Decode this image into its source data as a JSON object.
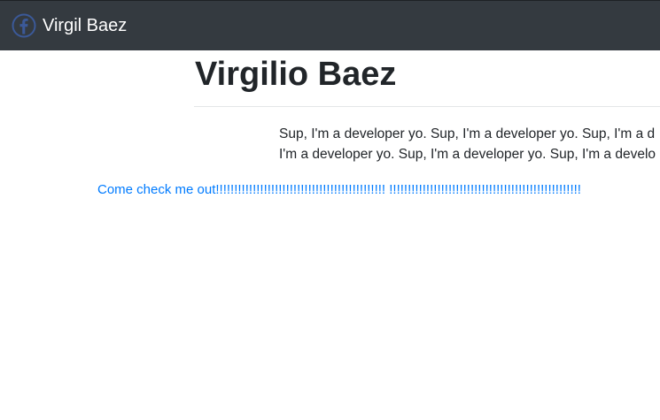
{
  "navbar": {
    "brand_icon": "facebook-icon",
    "brand_name": "Virgil Baez"
  },
  "header": {
    "title": "Virgilio Baez"
  },
  "bio": {
    "line1": "Sup, I'm a developer yo. Sup, I'm a developer yo. Sup, I'm a d",
    "line2": "I'm a developer yo. Sup, I'm a developer yo. Sup, I'm a develo"
  },
  "cta": {
    "link_text": "Come check me out!!!!!!!!!!!!!!!!!!!!!!!!!!!!!!!!!!!!!!!!!!!!!! !!!!!!!!!!!!!!!!!!!!!!!!!!!!!!!!!!!!!!!!!!!!!!!!!!!!"
  },
  "colors": {
    "navbar_bg": "#343a40",
    "link": "#007bff",
    "text": "#212529",
    "brand_icon": "#3b5998"
  }
}
